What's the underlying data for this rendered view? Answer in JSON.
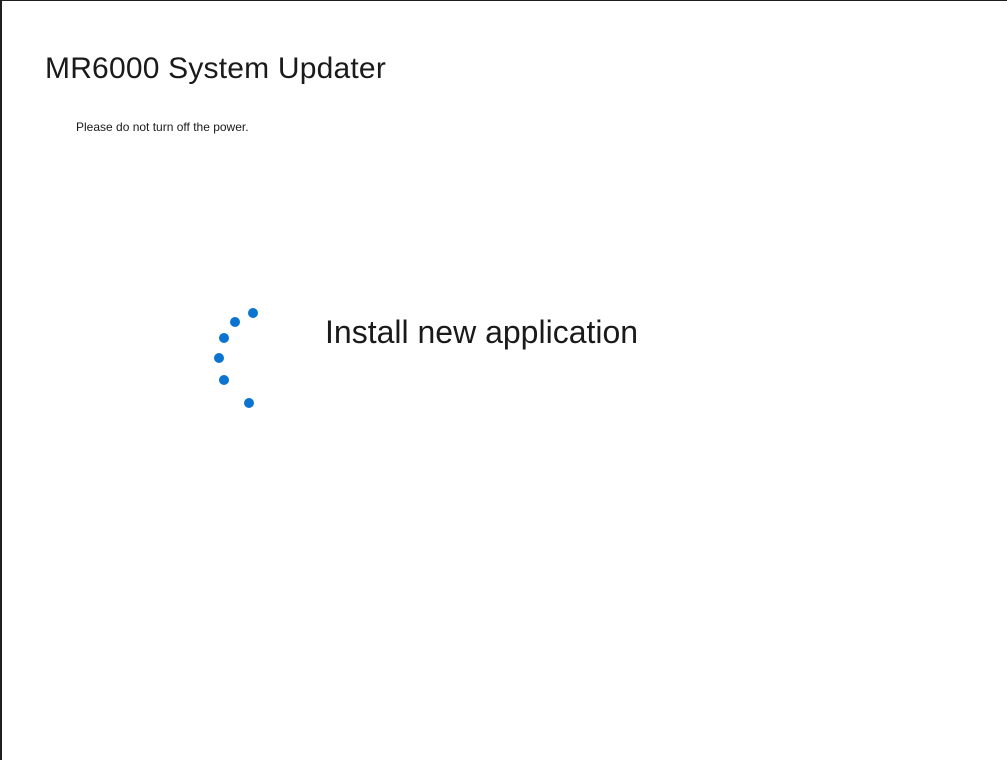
{
  "app": {
    "title": "MR6000 System Updater",
    "notice": "Please do not turn off the power."
  },
  "status": {
    "message": "Install new application",
    "indicator_icon": "busy-spinner-icon"
  },
  "colors": {
    "accent": "#0a74d0",
    "text": "#1a1a1a",
    "background": "#ffffff"
  }
}
